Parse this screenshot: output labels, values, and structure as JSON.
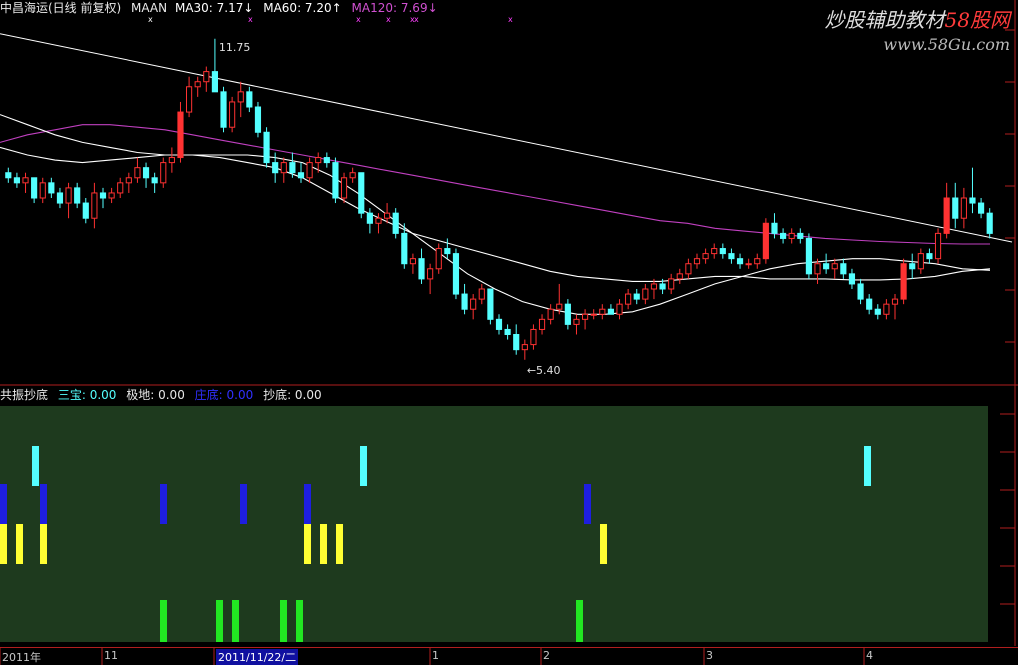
{
  "header": {
    "stock": "中昌海运(日线 前复权)",
    "maan": "MAAN",
    "ma30": "MA30: 7.17↓",
    "ma60": "MA60: 7.20↑",
    "ma120": "MA120: 7.69↓"
  },
  "watermark": {
    "line1_a": "炒股辅助教材",
    "line1_b": "58股网",
    "line2": "www.58Gu.com"
  },
  "indicator_header": {
    "name": "共振抄底",
    "sanbao": "三宝: 0.00",
    "jidi": "极地: 0.00",
    "zhuangdi": "庄底: 0.00",
    "chaodi": "抄底: 0.00"
  },
  "annotations": {
    "high": "11.75",
    "low": "←5.40"
  },
  "time_axis": [
    "2011年",
    "11",
    "2011/11/22/二",
    "1",
    "2",
    "3",
    "4"
  ],
  "colors": {
    "up": "#ff3232",
    "down": "#54ffff",
    "ma30": "#ffffff",
    "ma60": "#ffffff",
    "ma120": "#c040c0",
    "trend": "#ffffff",
    "panel_bg": "#1e3a1e",
    "sanbao": "#54ffff",
    "jidi": "#1e1ee0",
    "zhuangdi": "#ffff33",
    "chaodi": "#22e622",
    "border": "#b01e1e"
  },
  "chart_data": {
    "type": "candlestick",
    "price_range": [
      5.0,
      12.2
    ],
    "high": 11.75,
    "low": 5.4,
    "candles": [
      [
        9.1,
        9.2,
        8.9,
        9.0
      ],
      [
        9.0,
        9.1,
        8.8,
        8.9
      ],
      [
        8.9,
        9.1,
        8.7,
        9.0
      ],
      [
        9.0,
        9.0,
        8.5,
        8.6
      ],
      [
        8.6,
        9.0,
        8.5,
        8.9
      ],
      [
        8.9,
        9.0,
        8.6,
        8.7
      ],
      [
        8.7,
        8.8,
        8.4,
        8.5
      ],
      [
        8.5,
        8.9,
        8.2,
        8.8
      ],
      [
        8.8,
        8.9,
        8.4,
        8.5
      ],
      [
        8.5,
        8.6,
        8.1,
        8.2
      ],
      [
        8.2,
        8.9,
        8.0,
        8.7
      ],
      [
        8.7,
        8.8,
        8.4,
        8.6
      ],
      [
        8.6,
        8.8,
        8.5,
        8.7
      ],
      [
        8.7,
        9.0,
        8.6,
        8.9
      ],
      [
        8.9,
        9.1,
        8.7,
        9.0
      ],
      [
        9.0,
        9.4,
        8.9,
        9.2
      ],
      [
        9.2,
        9.3,
        8.8,
        9.0
      ],
      [
        9.0,
        9.1,
        8.7,
        8.9
      ],
      [
        8.9,
        9.4,
        8.8,
        9.3
      ],
      [
        9.3,
        9.6,
        9.1,
        9.4
      ],
      [
        9.4,
        10.5,
        9.3,
        10.3
      ],
      [
        10.3,
        11.0,
        10.2,
        10.8
      ],
      [
        10.8,
        11.0,
        10.6,
        10.9
      ],
      [
        10.9,
        11.2,
        10.7,
        11.1
      ],
      [
        11.1,
        11.75,
        10.8,
        10.7
      ],
      [
        10.7,
        10.8,
        9.9,
        10.0
      ],
      [
        10.0,
        10.6,
        9.9,
        10.5
      ],
      [
        10.5,
        10.9,
        10.2,
        10.7
      ],
      [
        10.7,
        10.8,
        10.3,
        10.4
      ],
      [
        10.4,
        10.5,
        9.8,
        9.9
      ],
      [
        9.9,
        10.0,
        9.2,
        9.3
      ],
      [
        9.3,
        9.5,
        8.9,
        9.1
      ],
      [
        9.1,
        9.4,
        8.9,
        9.3
      ],
      [
        9.3,
        9.5,
        9.0,
        9.1
      ],
      [
        9.1,
        9.3,
        8.9,
        9.0
      ],
      [
        9.0,
        9.4,
        8.9,
        9.3
      ],
      [
        9.3,
        9.5,
        9.1,
        9.4
      ],
      [
        9.4,
        9.5,
        9.2,
        9.3
      ],
      [
        9.3,
        9.4,
        8.5,
        8.6
      ],
      [
        8.6,
        9.1,
        8.5,
        9.0
      ],
      [
        9.0,
        9.2,
        8.9,
        9.1
      ],
      [
        9.1,
        9.1,
        8.2,
        8.3
      ],
      [
        8.3,
        8.4,
        7.9,
        8.1
      ],
      [
        8.1,
        8.3,
        7.9,
        8.2
      ],
      [
        8.2,
        8.5,
        8.1,
        8.3
      ],
      [
        8.3,
        8.4,
        7.8,
        7.9
      ],
      [
        7.9,
        8.1,
        7.2,
        7.3
      ],
      [
        7.3,
        7.5,
        7.1,
        7.4
      ],
      [
        7.4,
        7.6,
        6.9,
        7.0
      ],
      [
        7.0,
        7.3,
        6.7,
        7.2
      ],
      [
        7.2,
        7.7,
        7.1,
        7.6
      ],
      [
        7.6,
        7.8,
        7.4,
        7.5
      ],
      [
        7.5,
        7.6,
        6.6,
        6.7
      ],
      [
        6.7,
        6.9,
        6.3,
        6.4
      ],
      [
        6.4,
        6.7,
        6.2,
        6.6
      ],
      [
        6.6,
        6.9,
        6.5,
        6.8
      ],
      [
        6.8,
        6.8,
        6.1,
        6.2
      ],
      [
        6.2,
        6.3,
        5.9,
        6.0
      ],
      [
        6.0,
        6.1,
        5.8,
        5.9
      ],
      [
        5.9,
        6.1,
        5.5,
        5.6
      ],
      [
        5.6,
        5.8,
        5.4,
        5.7
      ],
      [
        5.7,
        6.1,
        5.6,
        6.0
      ],
      [
        6.0,
        6.3,
        5.9,
        6.2
      ],
      [
        6.2,
        6.5,
        6.1,
        6.4
      ],
      [
        6.4,
        6.9,
        6.3,
        6.5
      ],
      [
        6.5,
        6.6,
        6.0,
        6.1
      ],
      [
        6.1,
        6.3,
        5.9,
        6.2
      ],
      [
        6.2,
        6.4,
        6.0,
        6.3
      ],
      [
        6.3,
        6.4,
        6.2,
        6.3
      ],
      [
        6.3,
        6.5,
        6.2,
        6.4
      ],
      [
        6.4,
        6.5,
        6.3,
        6.3
      ],
      [
        6.3,
        6.6,
        6.2,
        6.5
      ],
      [
        6.5,
        6.8,
        6.4,
        6.7
      ],
      [
        6.7,
        6.8,
        6.5,
        6.6
      ],
      [
        6.6,
        6.9,
        6.5,
        6.8
      ],
      [
        6.8,
        7.0,
        6.6,
        6.9
      ],
      [
        6.9,
        7.0,
        6.7,
        6.8
      ],
      [
        6.8,
        7.1,
        6.7,
        7.0
      ],
      [
        7.0,
        7.2,
        6.9,
        7.1
      ],
      [
        7.1,
        7.4,
        7.0,
        7.3
      ],
      [
        7.3,
        7.5,
        7.2,
        7.4
      ],
      [
        7.4,
        7.6,
        7.3,
        7.5
      ],
      [
        7.5,
        7.7,
        7.4,
        7.6
      ],
      [
        7.6,
        7.7,
        7.4,
        7.5
      ],
      [
        7.5,
        7.6,
        7.3,
        7.4
      ],
      [
        7.4,
        7.5,
        7.2,
        7.3
      ],
      [
        7.3,
        7.4,
        7.2,
        7.3
      ],
      [
        7.3,
        7.5,
        7.2,
        7.4
      ],
      [
        7.4,
        8.2,
        7.3,
        8.1
      ],
      [
        8.1,
        8.3,
        7.8,
        7.9
      ],
      [
        7.9,
        8.0,
        7.7,
        7.8
      ],
      [
        7.8,
        8.0,
        7.7,
        7.9
      ],
      [
        7.9,
        8.0,
        7.7,
        7.8
      ],
      [
        7.8,
        7.9,
        7.0,
        7.1
      ],
      [
        7.1,
        7.4,
        6.9,
        7.3
      ],
      [
        7.3,
        7.5,
        7.1,
        7.2
      ],
      [
        7.2,
        7.4,
        7.0,
        7.3
      ],
      [
        7.3,
        7.4,
        7.0,
        7.1
      ],
      [
        7.1,
        7.2,
        6.8,
        6.9
      ],
      [
        6.9,
        7.0,
        6.5,
        6.6
      ],
      [
        6.6,
        6.7,
        6.3,
        6.4
      ],
      [
        6.4,
        6.5,
        6.2,
        6.3
      ],
      [
        6.3,
        6.6,
        6.2,
        6.5
      ],
      [
        6.5,
        6.7,
        6.2,
        6.6
      ],
      [
        6.6,
        7.4,
        6.5,
        7.3
      ],
      [
        7.3,
        7.5,
        7.0,
        7.2
      ],
      [
        7.2,
        7.6,
        7.1,
        7.5
      ],
      [
        7.5,
        7.6,
        7.3,
        7.4
      ],
      [
        7.4,
        8.0,
        7.3,
        7.9
      ],
      [
        7.9,
        8.9,
        7.8,
        8.6
      ],
      [
        8.6,
        8.9,
        8.0,
        8.2
      ],
      [
        8.2,
        8.8,
        8.0,
        8.6
      ],
      [
        8.6,
        9.2,
        8.3,
        8.5
      ],
      [
        8.5,
        8.6,
        8.2,
        8.3
      ],
      [
        8.3,
        8.4,
        7.8,
        7.9
      ]
    ],
    "ma30": [
      10.25,
      10.05,
      9.85,
      9.7,
      9.6,
      9.5,
      9.45,
      9.45,
      9.45,
      9.45,
      9.4,
      9.3,
      9.05,
      8.7,
      8.3,
      7.9,
      7.5,
      7.1,
      6.8,
      6.55,
      6.4,
      6.3,
      6.3,
      6.35,
      6.5,
      6.7,
      6.9,
      7.05,
      7.2,
      7.3,
      7.35,
      7.4,
      7.4,
      7.35,
      7.3,
      7.2,
      7.17
    ],
    "ma60": [
      9.6,
      9.45,
      9.35,
      9.3,
      9.35,
      9.4,
      9.45,
      9.45,
      9.4,
      9.3,
      9.2,
      9.0,
      8.7,
      8.4,
      8.15,
      7.9,
      7.75,
      7.6,
      7.45,
      7.3,
      7.15,
      7.05,
      7.0,
      6.95,
      6.95,
      7.0,
      7.05,
      7.05,
      7.0,
      7.0,
      7.0,
      6.98,
      6.98,
      7.0,
      7.05,
      7.15,
      7.2
    ],
    "ma120": [
      9.7,
      9.85,
      9.95,
      10.05,
      10.05,
      10.0,
      9.95,
      9.85,
      9.75,
      9.65,
      9.55,
      9.45,
      9.35,
      9.25,
      9.15,
      9.05,
      8.95,
      8.85,
      8.75,
      8.65,
      8.55,
      8.45,
      8.35,
      8.25,
      8.15,
      8.1,
      8.0,
      7.95,
      7.9,
      7.85,
      7.8,
      7.77,
      7.74,
      7.72,
      7.7,
      7.69,
      7.69
    ],
    "trendline": [
      [
        0,
        11.85
      ],
      [
        1.0,
        7.73
      ]
    ],
    "signals": {
      "sanbao": [
        4,
        45,
        108
      ],
      "jidi": [
        0,
        5,
        20,
        30,
        38,
        73
      ],
      "zhuangdi": [
        0,
        2,
        5,
        38,
        40,
        42,
        75
      ],
      "chaodi": [
        20,
        27,
        29,
        35,
        37,
        72
      ]
    }
  }
}
